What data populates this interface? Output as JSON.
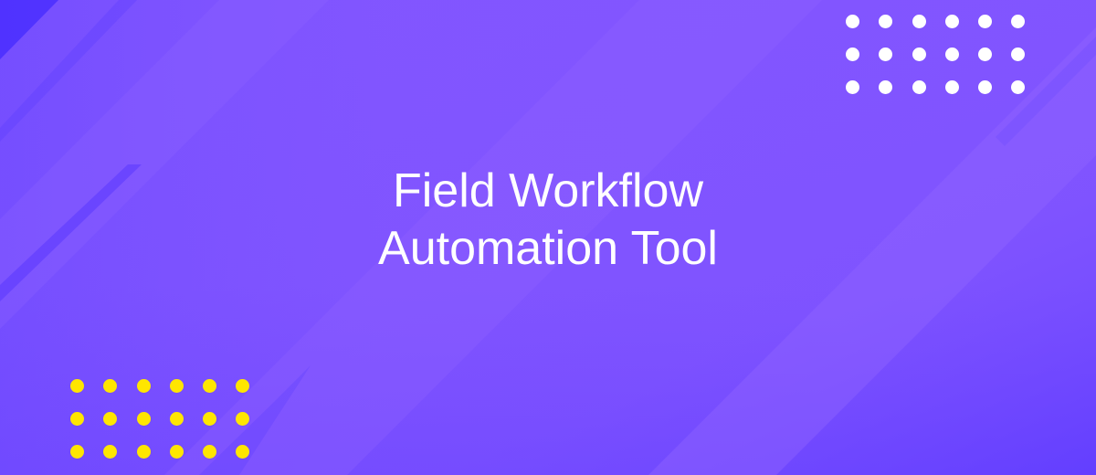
{
  "banner": {
    "title_lines": [
      "Field Workflow",
      "Automation Tool"
    ],
    "colors": {
      "background": "#8356ff",
      "band_light": "#8b5cff",
      "band_dark": "#5a3cff",
      "corner_accent": "#4a2eff",
      "title_text": "#ffffff",
      "dots_top_right": "#ffffff",
      "dots_bottom_left": "#ffe600"
    },
    "decorations": {
      "dots_top_right": {
        "rows": 3,
        "columns": 6,
        "icon": "dot-pattern-icon"
      },
      "dots_bottom_left": {
        "rows": 3,
        "columns": 6,
        "icon": "dot-pattern-icon"
      }
    }
  }
}
